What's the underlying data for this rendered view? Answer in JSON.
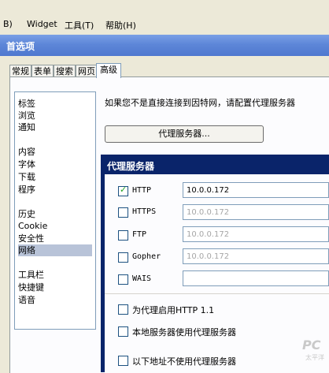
{
  "menubar": {
    "items": [
      "B)",
      "Widget",
      "工具(T)",
      "帮助(H)"
    ]
  },
  "window": {
    "title": "首选项"
  },
  "tabs": [
    "常规",
    "表单",
    "搜索",
    "网页",
    "高级"
  ],
  "sidebar": {
    "items": [
      "标签",
      "浏览",
      "通知",
      "内容",
      "字体",
      "下载",
      "程序",
      "历史",
      "Cookie",
      "安全性",
      "网络",
      "工具栏",
      "快捷键",
      "语音"
    ],
    "selected": "网络"
  },
  "main": {
    "info_text": "如果您不是直接连接到因特网，请配置代理服务器",
    "proxy_button": "代理服务器..."
  },
  "dialog": {
    "title": "代理服务器",
    "rows": [
      {
        "label": "HTTP",
        "checked": true,
        "value": "10.0.0.172"
      },
      {
        "label": "HTTPS",
        "checked": false,
        "value": "10.0.0.172"
      },
      {
        "label": "FTP",
        "checked": false,
        "value": "10.0.0.172"
      },
      {
        "label": "Gopher",
        "checked": false,
        "value": "10.0.0.172"
      },
      {
        "label": "WAIS",
        "checked": false,
        "value": ""
      }
    ],
    "options": [
      {
        "label": "为代理启用HTTP 1.1",
        "checked": false
      },
      {
        "label": "本地服务器使用代理服务器",
        "checked": false
      },
      {
        "label": "以下地址不使用代理服务器",
        "checked": false
      }
    ]
  },
  "watermark": {
    "text": "PC",
    "sub": "太平洋"
  },
  "colors": {
    "dialog_title_bg": "#0a246a",
    "selected_bg": "#b8c3d8",
    "check": "#21a121"
  }
}
